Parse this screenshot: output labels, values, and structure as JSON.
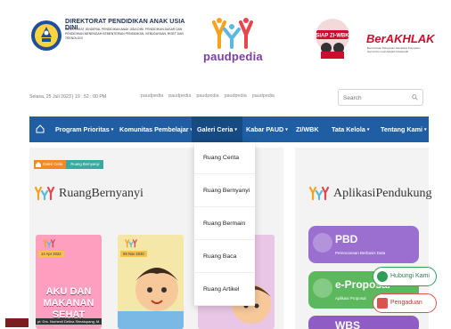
{
  "header": {
    "directorate_title": "DIREKTORAT PENDIDIKAN ANAK USIA DINI",
    "directorate_sub": "Direktorat Jenderal Pendidikan Anak Usia Dini, Pendidikan Dasar dan Pendidikan Menengah Kementerian Pendidikan, Kebudayaan, Riset dan Teknologi",
    "paudpedia": "paudpedia",
    "siap_badge": "SIAP ZI-WBK",
    "berakhlak_title": "BerAKHLAK",
    "berakhlak_sub": "Berorientasi Pelayanan Akuntabel Kompeten Harmonis Loyal Adaptif Kolaboratif"
  },
  "subbar": {
    "datetime": "Selasa, 25 Juli 2023 | 19 : 52 : 00 PM",
    "quicklinks": [
      "paudpedia",
      "paudpedia",
      "paudpedia",
      "paudpedia",
      "paudpedia"
    ],
    "search_placeholder": "Search"
  },
  "nav": {
    "items": [
      {
        "label": "Program Prioritas"
      },
      {
        "label": "Komunitas Pembelajar"
      },
      {
        "label": "Galeri Ceria"
      },
      {
        "label": "Kabar PAUD"
      },
      {
        "label": "ZI/WBK"
      },
      {
        "label": "Tata Kelola"
      },
      {
        "label": "Tentang Kami"
      }
    ],
    "caret": "▾",
    "active": "Galeri Ceria"
  },
  "dropdown": {
    "items": [
      "Ruang Cerita",
      "Ruang Bernyanyi",
      "Ruang Bermain",
      "Ruang Baca",
      "Ruang Artikel"
    ]
  },
  "breadcrumb": [
    "Galeri Ceria",
    "Ruang Bernyanyi"
  ],
  "main": {
    "title": "RuangBernyanyi",
    "cards": [
      {
        "date": "14 Apr 2022",
        "title": "AKU DAN MAKANAN SEHAT",
        "author": "pt: Drs. Nurhenil Delina Simatupang, M."
      },
      {
        "date": "09 Nov 2020"
      }
    ]
  },
  "sidebar": {
    "title": "AplikasiPendukung",
    "tiles": [
      {
        "title": "PBD",
        "sub": "Perencanaan Berbasis Data"
      },
      {
        "title": "e-Proposal",
        "sub": "Aplikasi Proposal"
      },
      {
        "title": "WBS",
        "sub": ""
      }
    ]
  },
  "floating": {
    "hubungi": "Hubungi Kami",
    "pengaduan": "Pengaduan"
  },
  "colors": {
    "nav": "#1f5ea3",
    "nav_active": "#164a82",
    "brand_purple": "#7b3fa0",
    "berakhlak_red": "#c8102e",
    "tile_purple": "#9a6fd0",
    "tile_green": "#5cb85c"
  }
}
